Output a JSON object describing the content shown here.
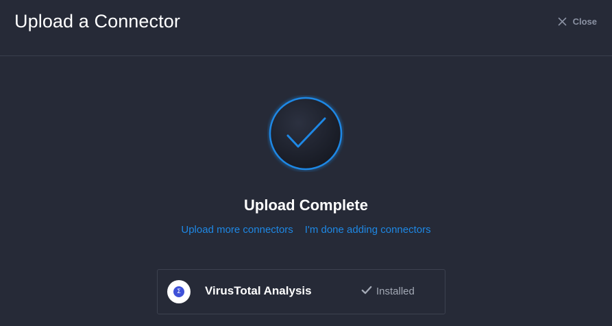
{
  "header": {
    "title": "Upload a Connector",
    "close_label": "Close"
  },
  "status": {
    "title": "Upload Complete"
  },
  "links": {
    "upload_more": "Upload more connectors",
    "done": "I'm done adding connectors"
  },
  "connector": {
    "name": "VirusTotal Analysis",
    "status_label": "Installed",
    "logo_glyph": "Σ"
  },
  "icons": {
    "close": "x-icon",
    "success": "checkmark-circle-icon",
    "installed": "check-icon"
  },
  "colors": {
    "background": "#262a37",
    "accent": "#1e88e5",
    "text": "#ffffff",
    "muted": "#8b92a3"
  }
}
